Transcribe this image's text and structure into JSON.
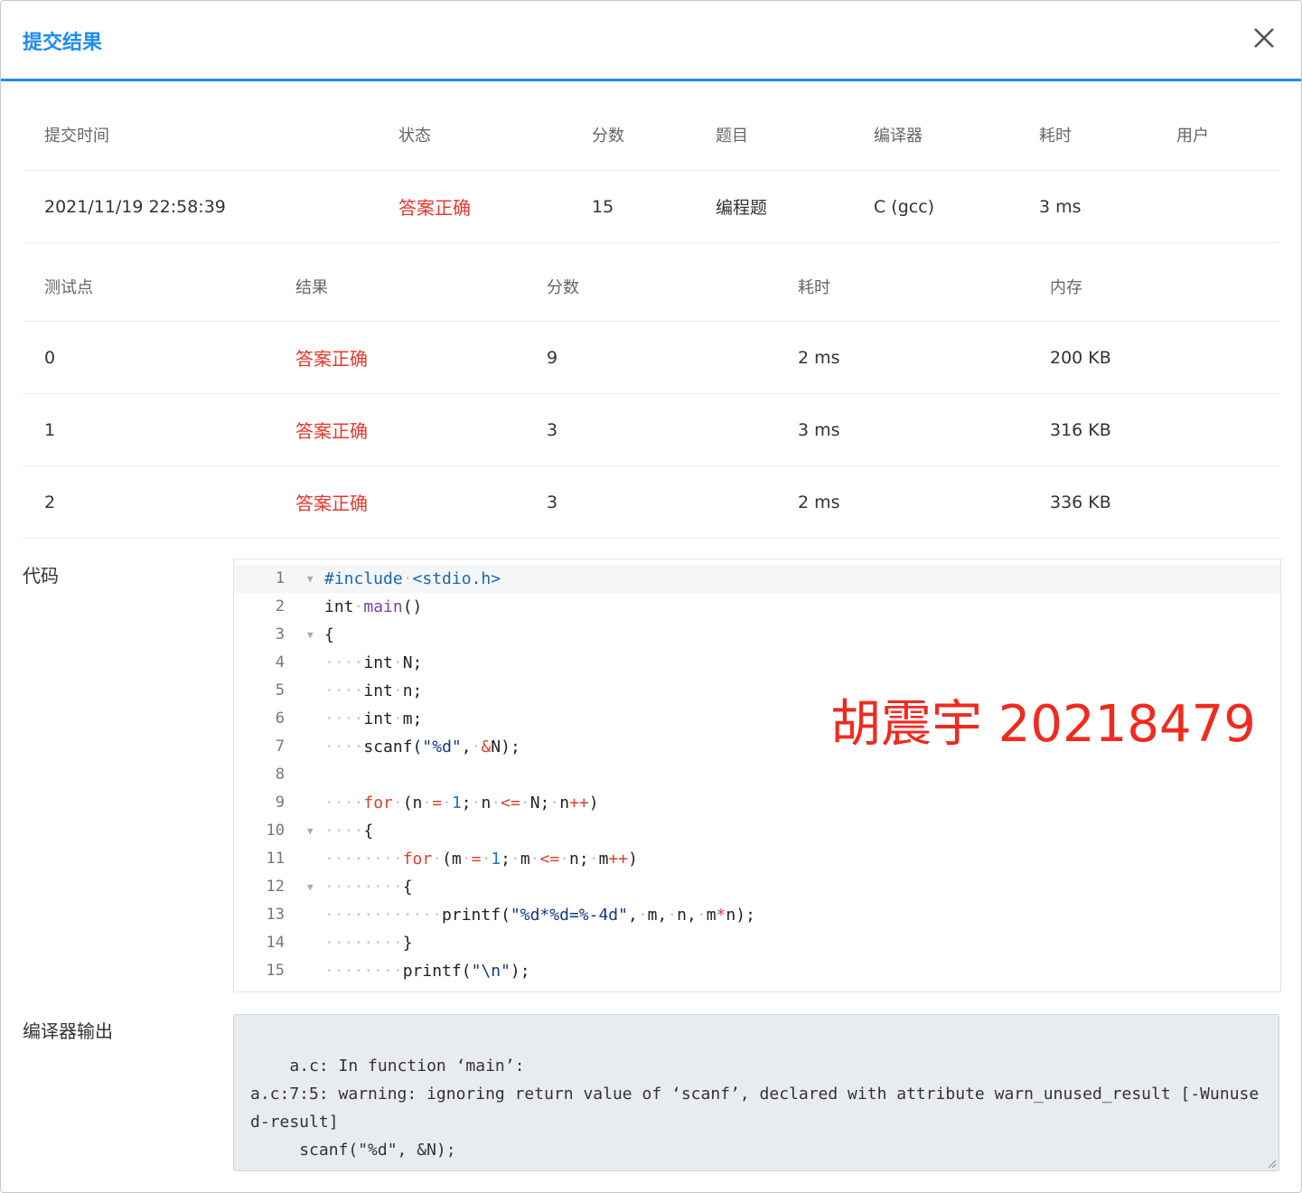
{
  "dialog": {
    "title": "提交结果"
  },
  "summary": {
    "headers": [
      "提交时间",
      "状态",
      "分数",
      "题目",
      "编译器",
      "耗时",
      "用户"
    ],
    "row": {
      "time": "2021/11/19 22:58:39",
      "status": "答案正确",
      "score": "15",
      "problem": "编程题",
      "compiler": "C (gcc)",
      "elapsed": "3 ms",
      "user": ""
    }
  },
  "testcases": {
    "headers": [
      "测试点",
      "结果",
      "分数",
      "耗时",
      "内存"
    ],
    "rows": [
      {
        "id": "0",
        "result": "答案正确",
        "score": "9",
        "time": "2 ms",
        "memory": "200 KB"
      },
      {
        "id": "1",
        "result": "答案正确",
        "score": "3",
        "time": "3 ms",
        "memory": "316 KB"
      },
      {
        "id": "2",
        "result": "答案正确",
        "score": "3",
        "time": "2 ms",
        "memory": "336 KB"
      }
    ]
  },
  "code_section": {
    "label": "代码",
    "line_numbers": [
      "1",
      "2",
      "3",
      "4",
      "5",
      "6",
      "7",
      "8",
      "9",
      "10",
      "11",
      "12",
      "13",
      "14",
      "15"
    ],
    "lines": [
      "#include <stdio.h>",
      "int main()",
      "{",
      "    int N;",
      "    int n;",
      "    int m;",
      "    scanf(\"%d\", &N);",
      "",
      "    for (n = 1; n <= N; n++)",
      "    {",
      "        for (m = 1; m <= n; m++)",
      "        {",
      "            printf(\"%d*%d=%-4d\", m, n, m*n);",
      "        }",
      "        printf(\"\\n\");"
    ]
  },
  "watermark": {
    "text": "胡震宇 20218479"
  },
  "compiler_output": {
    "label": "编译器输出",
    "text": "a.c: In function ‘main’:\na.c:7:5: warning: ignoring return value of ‘scanf’, declared with attribute warn_unused_result [-Wunused-result]\n     scanf(\"%d\", &N);\n     ^~~~~~~~~~~~~~~"
  },
  "colors": {
    "accent": "#1e8cf0",
    "success_red": "#e8372c",
    "watermark_red": "#f02a1f"
  }
}
